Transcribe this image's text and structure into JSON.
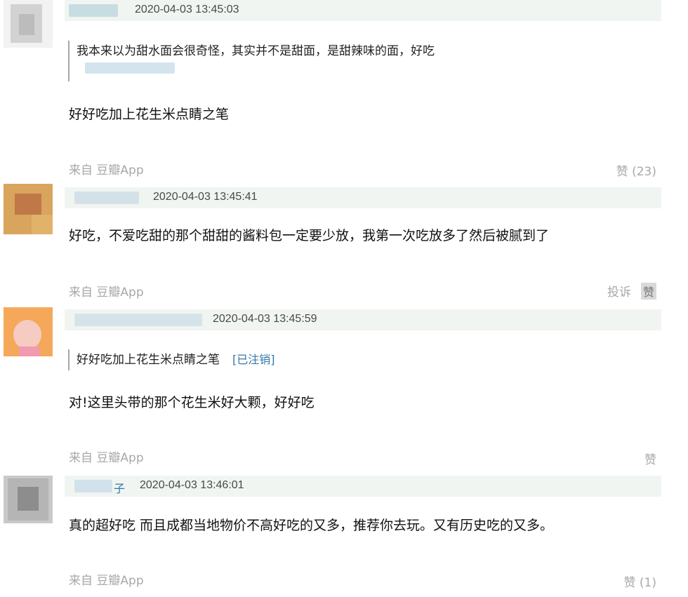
{
  "comments": [
    {
      "timestamp": "2020-04-03 13:45:03",
      "quote_text": "我本来以为甜水面会很奇怪，其实并不是甜面，是甜辣味的面，好吃",
      "quote_author": "",
      "body": "好好吃加上花生米点睛之笔",
      "source": "来自 豆瓣App",
      "vote_label": "赞 (23)"
    },
    {
      "timestamp": "2020-04-03 13:45:41",
      "body": "好吃，不爱吃甜的那个甜甜的酱料包一定要少放，我第一次吃放多了然后被腻到了",
      "source": "来自 豆瓣App",
      "report_label": "投诉",
      "vote_label": "赞"
    },
    {
      "timestamp": "2020-04-03 13:45:59",
      "quote_text": "好好吃加上花生米点睛之笔",
      "quote_author": "[已注销]",
      "body": "对!这里头带的那个花生米好大颗，好好吃",
      "source": "来自 豆瓣App",
      "vote_label": "赞"
    },
    {
      "name_fragment": "子",
      "timestamp": "2020-04-03 13:46:01",
      "body": "真的超好吃 而且成都当地物价不高好吃的又多，推荐你去玩。又有历史吃的又多。",
      "source": "来自 豆瓣App",
      "vote_label": "赞 (1)"
    }
  ]
}
